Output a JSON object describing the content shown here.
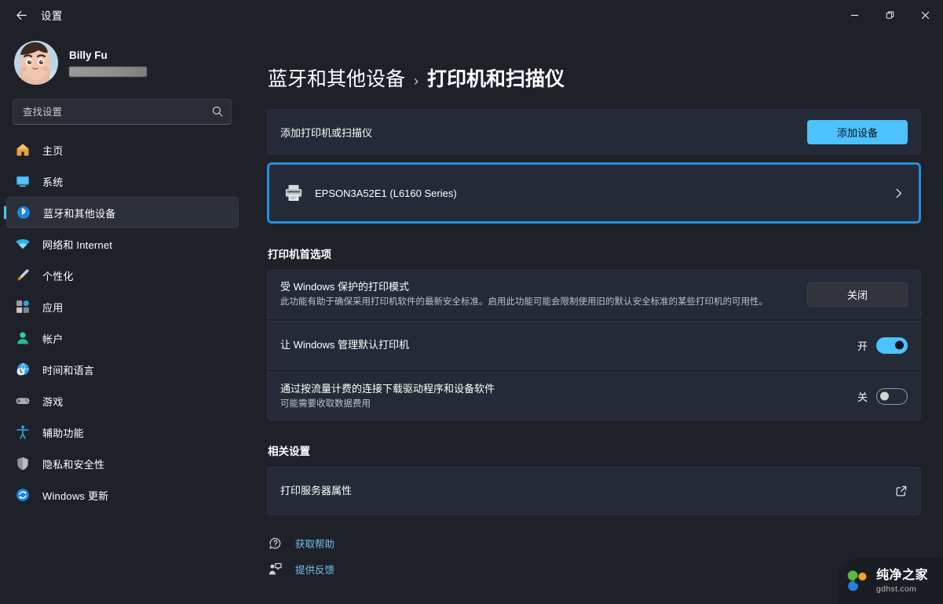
{
  "titlebar": {
    "back_icon": "back-arrow-icon",
    "title": "设置",
    "minimize_label": "—",
    "restore_label": "❐",
    "close_label": "✕"
  },
  "account": {
    "name": "Billy Fu",
    "email_redacted": true
  },
  "search": {
    "placeholder": "查找设置",
    "value": "",
    "icon": "search-icon"
  },
  "sidebar": {
    "items": [
      {
        "label": "主页",
        "icon": "home-icon",
        "selected": false
      },
      {
        "label": "系统",
        "icon": "system-icon",
        "selected": false
      },
      {
        "label": "蓝牙和其他设备",
        "icon": "bluetooth-icon",
        "selected": true
      },
      {
        "label": "网络和 Internet",
        "icon": "network-icon",
        "selected": false
      },
      {
        "label": "个性化",
        "icon": "personalization-icon",
        "selected": false
      },
      {
        "label": "应用",
        "icon": "apps-icon",
        "selected": false
      },
      {
        "label": "帐户",
        "icon": "accounts-icon",
        "selected": false
      },
      {
        "label": "时间和语言",
        "icon": "time-language-icon",
        "selected": false
      },
      {
        "label": "游戏",
        "icon": "gaming-icon",
        "selected": false
      },
      {
        "label": "辅助功能",
        "icon": "accessibility-icon",
        "selected": false
      },
      {
        "label": "隐私和安全性",
        "icon": "privacy-security-icon",
        "selected": false
      },
      {
        "label": "Windows 更新",
        "icon": "windows-update-icon",
        "selected": false
      }
    ]
  },
  "breadcrumb": {
    "parent": "蓝牙和其他设备",
    "separator": "›",
    "current": "打印机和扫描仪"
  },
  "add_printer": {
    "label": "添加打印机或扫描仪",
    "button_label": "添加设备"
  },
  "printer": {
    "name": "EPSON3A52E1 (L6160 Series)",
    "icon": "printer-icon",
    "chevron": "chevron-right-icon",
    "highlighted": true,
    "highlight_color": "#2291e0"
  },
  "printer_preferences": {
    "section_title": "打印机首选项",
    "rows": [
      {
        "title": "受 Windows 保护的打印模式",
        "desc": "此功能有助于确保采用打印机软件的最新安全标准。启用此功能可能会限制使用旧的默认安全标准的某些打印机的可用性。",
        "control": "button",
        "button_label": "关闭"
      },
      {
        "title": "让 Windows 管理默认打印机",
        "desc": "",
        "control": "toggle",
        "toggle_state_label": "开",
        "toggle_on": true
      },
      {
        "title": "通过按流量计费的连接下载驱动程序和设备软件",
        "desc": "可能需要收取数据费用",
        "control": "toggle",
        "toggle_state_label": "关",
        "toggle_on": false
      }
    ]
  },
  "related_settings": {
    "section_title": "相关设置",
    "rows": [
      {
        "title": "打印服务器属性",
        "icon": "external-link-icon"
      }
    ]
  },
  "footer": {
    "links": [
      {
        "label": "获取帮助",
        "icon": "help-icon"
      },
      {
        "label": "提供反馈",
        "icon": "feedback-icon"
      }
    ]
  },
  "watermark": {
    "title": "纯净之家",
    "subtitle": "gdhst.com",
    "logo": "gdhst-logo-icon"
  },
  "colors": {
    "accent": "#4cc2ff",
    "highlight": "#2291e0",
    "card_bg": "#252a38",
    "window_bg": "#1f2129",
    "link": "#6fc0f0"
  }
}
